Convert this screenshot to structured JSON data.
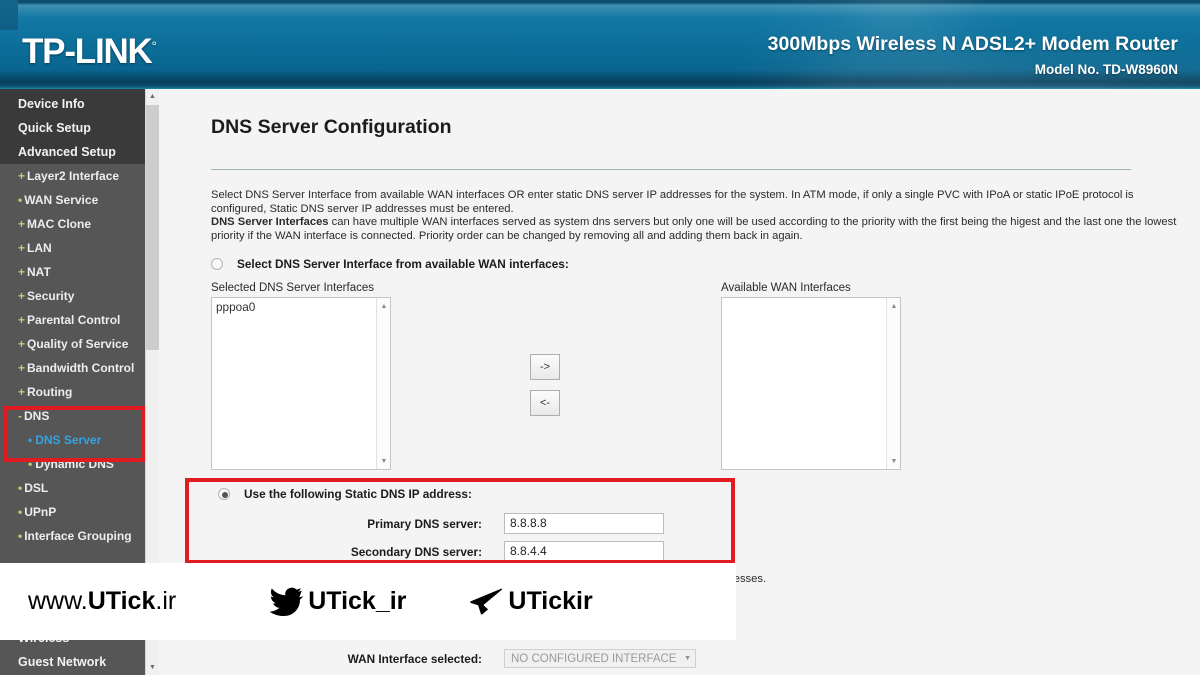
{
  "header": {
    "brand": "TP-LINK",
    "brand_mark": "°",
    "product": "300Mbps Wireless N ADSL2+ Modem Router",
    "model": "Model No. TD-W8960N",
    "bg_color": "#0b6e98"
  },
  "sidebar": {
    "top_items": [
      {
        "label": "Device Info"
      },
      {
        "label": "Quick Setup"
      },
      {
        "label": "Advanced Setup"
      }
    ],
    "items": [
      {
        "marker": "+",
        "label": "Layer2 Interface",
        "level": 1
      },
      {
        "marker": "•",
        "label": "WAN Service",
        "level": 1
      },
      {
        "marker": "+",
        "label": "MAC Clone",
        "level": 1
      },
      {
        "marker": "+",
        "label": "LAN",
        "level": 1
      },
      {
        "marker": "+",
        "label": "NAT",
        "level": 1
      },
      {
        "marker": "+",
        "label": "Security",
        "level": 1
      },
      {
        "marker": "+",
        "label": "Parental Control",
        "level": 1
      },
      {
        "marker": "+",
        "label": "Quality of Service",
        "level": 1
      },
      {
        "marker": "+",
        "label": "Bandwidth Control",
        "level": 1
      },
      {
        "marker": "+",
        "label": "Routing",
        "level": 1
      },
      {
        "marker": "-",
        "label": "DNS",
        "level": 1
      },
      {
        "marker": "•",
        "label": "DNS Server",
        "level": 2,
        "active": true
      },
      {
        "marker": "•",
        "label": "Dynamic DNS",
        "level": 2
      },
      {
        "marker": "•",
        "label": "DSL",
        "level": 1
      },
      {
        "marker": "•",
        "label": "UPnP",
        "level": 1
      },
      {
        "marker": "•",
        "label": "Interface Grouping",
        "level": 1
      },
      {
        "marker": "",
        "label": "Wireless",
        "level": 0
      },
      {
        "marker": "",
        "label": "Guest Network",
        "level": 0
      }
    ],
    "active_color": "#35a3e0",
    "marker_color": "#c9c37a",
    "scrollbar": {
      "up": "▲",
      "down": "▼"
    }
  },
  "main": {
    "title": "DNS Server Configuration",
    "description_parts": {
      "p1": "Select DNS Server Interface from available WAN interfaces OR enter static DNS server IP addresses for the system. In ATM mode, if only a single PVC with IPoA or static IPoE protocol is configured, Static DNS server IP addresses must be entered.",
      "p2_bold": "DNS Server Interfaces",
      "p2_rest": " can have multiple WAN interfaces served as system dns servers but only one will be used according to the priority with the first being the higest and the last one the lowest priority if the WAN interface is connected. Priority order can be changed by removing all and adding them back in again."
    },
    "option_interface": {
      "label": "Select DNS Server Interface from available WAN interfaces:",
      "selected": false
    },
    "selected_list": {
      "label": "Selected DNS Server Interfaces",
      "items": [
        "pppoa0"
      ]
    },
    "available_list": {
      "label": "Available WAN Interfaces",
      "items": []
    },
    "buttons": {
      "add": "->",
      "remove": "<-"
    },
    "option_static": {
      "label": "Use the following Static DNS IP address:",
      "selected": true
    },
    "fields": [
      {
        "label": "Primary DNS server:",
        "value": "8.8.8.8",
        "placeholder": ""
      },
      {
        "label": "Secondary DNS server:",
        "value": "8.8.4.4",
        "placeholder": ""
      }
    ],
    "occluded_note": "resses.",
    "wan_interface": {
      "label": "WAN Interface selected:",
      "value": "NO CONFIGURED INTERFACE",
      "caret": "▼"
    }
  },
  "annotations": {
    "color": "#e01b22",
    "boxes": [
      {
        "name": "dns-menu-highlight"
      },
      {
        "name": "static-dns-highlight"
      }
    ]
  },
  "watermark": {
    "site_prefix": "www.",
    "site_strong": "UTick",
    "site_suffix": ".ir",
    "twitter_handle": "UTick_ir",
    "telegram_handle": "UTickir"
  }
}
